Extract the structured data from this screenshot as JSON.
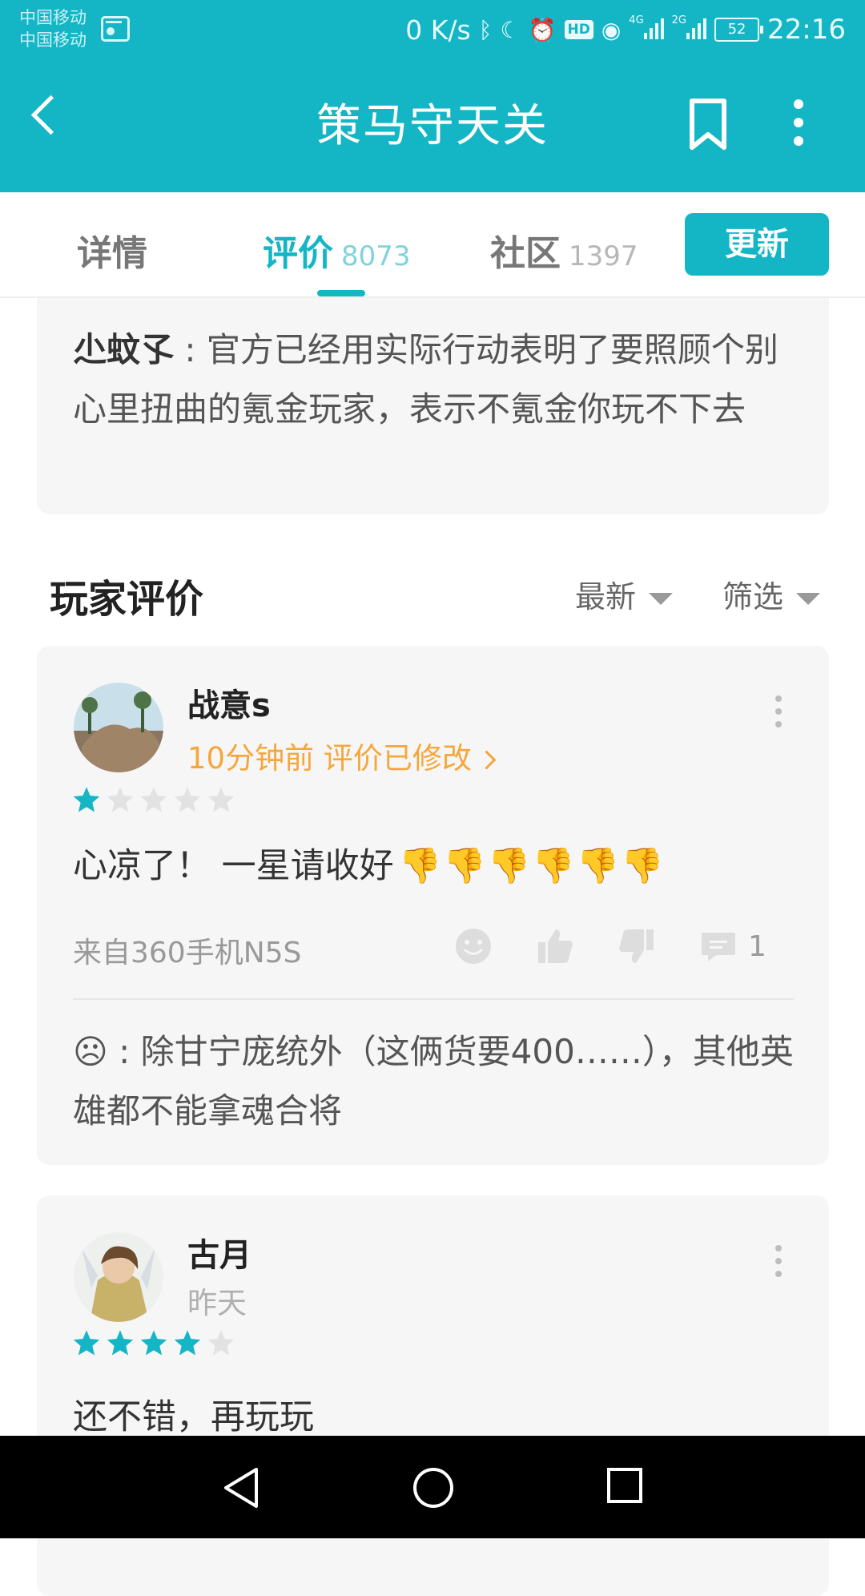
{
  "status_bar": {
    "carrier1": "中国移动",
    "carrier2": "中国移动",
    "speed": "0 K/s",
    "hd": "HD",
    "net1": "4G",
    "net2": "2G",
    "battery": "52",
    "time": "22:16"
  },
  "header": {
    "title": "策马守天关"
  },
  "tabs": [
    {
      "label": "详情",
      "count": ""
    },
    {
      "label": "评价",
      "count": "8073"
    },
    {
      "label": "社区",
      "count": "1397"
    }
  ],
  "update_label": "更新",
  "reply_card": {
    "author": "尐蚊孓",
    "sep": " : ",
    "text": "官方已经用实际行动表明了要照顾个别心里扭曲的氪金玩家，表示不氪金你玩不下去"
  },
  "section": {
    "title": "玩家评价",
    "sort": "最新",
    "filter": "筛选"
  },
  "reviews": [
    {
      "user": "战意s",
      "meta": "10分钟前 评价已修改",
      "rating": 1,
      "text": "心凉了！ 一星请收好",
      "thumbs": "👎👎👎👎👎👎",
      "device": "来自360手机N5S",
      "comment_count": "1",
      "reply_icon": "☹",
      "reply_text": " : 除甘宁庞统外（这俩货要400……），其他英雄都不能拿魂合将"
    },
    {
      "user": "古月",
      "meta": "昨天",
      "rating": 4,
      "text": "还不错，再玩玩"
    }
  ],
  "colors": {
    "accent": "#14b6c6",
    "orange": "#f5a73b",
    "card_bg": "#f6f6f6"
  }
}
